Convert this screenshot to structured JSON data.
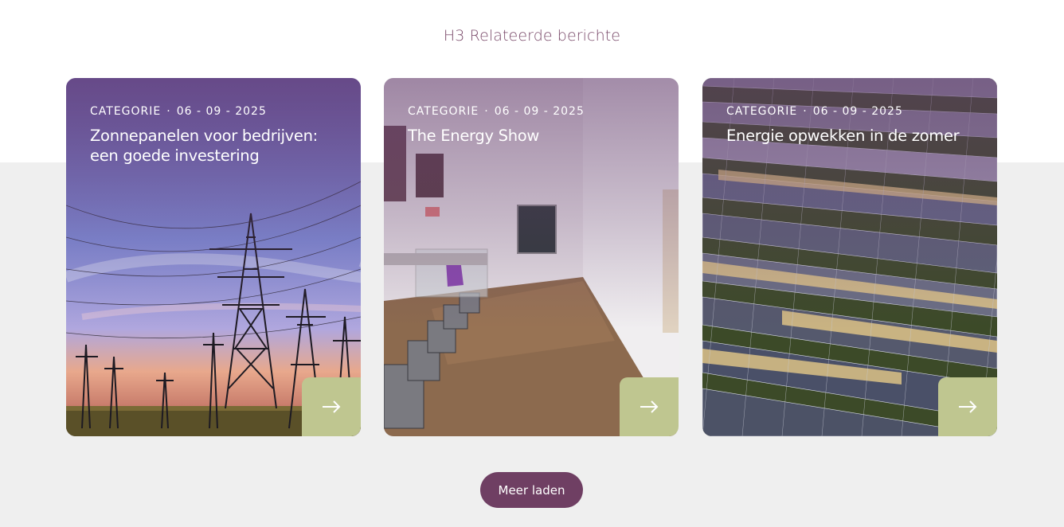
{
  "section": {
    "title": "H3 Relateerde berichte"
  },
  "cards": [
    {
      "category": "CATEGORIE",
      "separator": "·",
      "date": "06 - 09 - 2025",
      "title": "Zonnepanelen voor bedrijven: een goede investering"
    },
    {
      "category": "CATEGORIE",
      "separator": "·",
      "date": "06 - 09 - 2025",
      "title": "The Energy Show"
    },
    {
      "category": "CATEGORIE",
      "separator": "·",
      "date": "06 - 09 - 2025",
      "title": "Energie opwekken in de zomer"
    }
  ],
  "load_more": {
    "label": "Meer laden"
  },
  "colors": {
    "accent": "#6f3f63",
    "arrow_button": "#bfc690",
    "band": "#efefef"
  }
}
